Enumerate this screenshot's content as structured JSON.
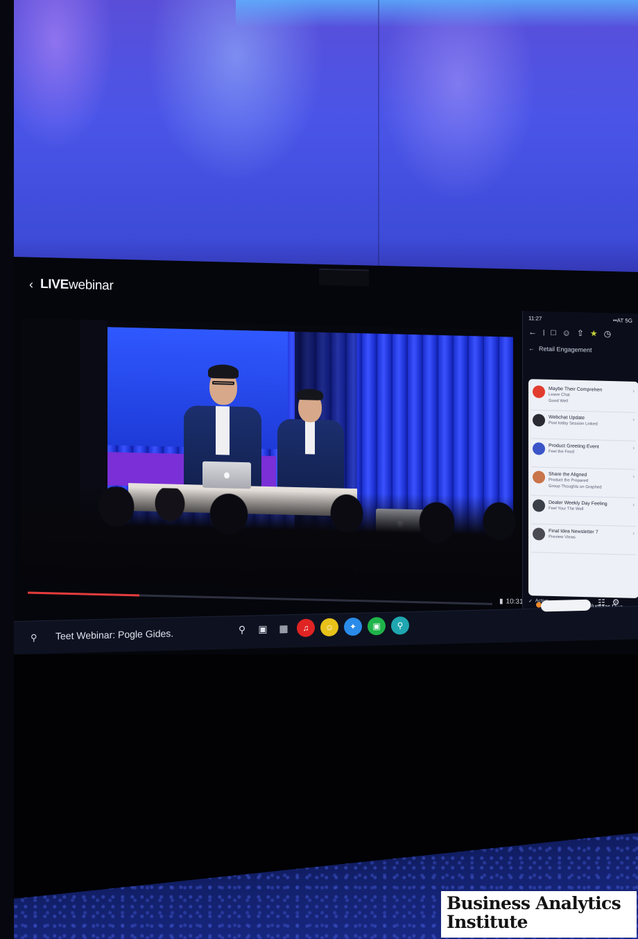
{
  "header": {
    "back_icon": "chevron-left-icon",
    "title_bold": "LIVE",
    "title_rest": "webinar"
  },
  "video": {
    "progress_fraction": 0.24,
    "time": "10:31",
    "fullscreen_icon": "sidebar-toggle-icon"
  },
  "phone": {
    "status_time": "11:27",
    "status_right": "••AT 5G",
    "panel_title": "Retail Engagement",
    "footer_text": "Active",
    "bottom_text": "badetopost aa#7/uplaar Due",
    "chat_items": [
      {
        "title": "Maybe Their Comprehen",
        "sub": "Leave Chat",
        "sub2": "Good Well",
        "color": "#e23c2e"
      },
      {
        "title": "Webchat Update",
        "sub": "Post today Session Linked",
        "sub2": "",
        "color": "#2a2a33"
      },
      {
        "title": "Product Greeting Event",
        "sub": "Feel the Feed",
        "sub2": "",
        "color": "#3b55c8"
      },
      {
        "title": "Share the Aligned",
        "sub": "Product the Prepared",
        "sub2": "Group Thoughts on Graphed",
        "color": "#c9744a"
      },
      {
        "title": "Dealer Weekly Day Feeling",
        "sub": "Feel Your The Well",
        "sub2": "",
        "color": "#3a3f48"
      },
      {
        "title": "Final Idea Newsletter 7",
        "sub": "Preview Views",
        "sub2": "",
        "color": "#4a4a52"
      }
    ]
  },
  "taskbar": {
    "lock_icon": "lock-icon",
    "title": "Teet Webinar: Pogle Gides.",
    "icons": [
      "search-icon",
      "document-icon",
      "calendar-icon"
    ],
    "apps": [
      {
        "name": "music-app-icon",
        "glyph": "♫",
        "color": "#e02424"
      },
      {
        "name": "chat-app-icon",
        "glyph": "☺",
        "color": "#e8c11a"
      },
      {
        "name": "bird-app-icon",
        "glyph": "✦",
        "color": "#2a8be8"
      },
      {
        "name": "green-app-icon",
        "glyph": "▣",
        "color": "#1fb44a"
      },
      {
        "name": "pin-app-icon",
        "glyph": "⚲",
        "color": "#1fa6b0"
      }
    ]
  },
  "logo": {
    "line1": "Business Analytics",
    "line2": "Institute"
  }
}
